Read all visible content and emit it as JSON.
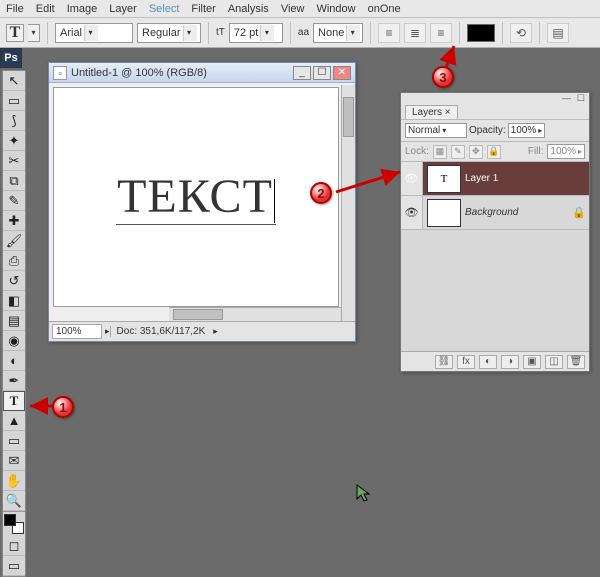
{
  "menu": {
    "items": [
      "File",
      "Edit",
      "Image",
      "Layer",
      "Select",
      "Filter",
      "Analysis",
      "View",
      "Window",
      "onOne"
    ],
    "highlight_index": 4
  },
  "options_bar": {
    "tool_letter": "T",
    "font_family": "Arial",
    "font_style": "Regular",
    "size_prefix_icon": "tT",
    "font_size": "72 pt",
    "aa_prefix": "aa",
    "anti_alias": "None",
    "color_hex": "#000000"
  },
  "app_strip": "Ps",
  "tools": [
    {
      "name": "move-tool",
      "glyph": "↖"
    },
    {
      "name": "marquee-tool",
      "glyph": "▭"
    },
    {
      "name": "lasso-tool",
      "glyph": "⟆"
    },
    {
      "name": "magic-wand-tool",
      "glyph": "✦"
    },
    {
      "name": "crop-tool",
      "glyph": "✂"
    },
    {
      "name": "slice-tool",
      "glyph": "⧉"
    },
    {
      "name": "eyedropper-tool",
      "glyph": "✎"
    },
    {
      "name": "healing-brush-tool",
      "glyph": "✚"
    },
    {
      "name": "brush-tool",
      "glyph": "🖌"
    },
    {
      "name": "clone-stamp-tool",
      "glyph": "⎙"
    },
    {
      "name": "history-brush-tool",
      "glyph": "↺"
    },
    {
      "name": "eraser-tool",
      "glyph": "◧"
    },
    {
      "name": "gradient-tool",
      "glyph": "▤"
    },
    {
      "name": "blur-tool",
      "glyph": "◉"
    },
    {
      "name": "dodge-tool",
      "glyph": "◐"
    },
    {
      "name": "pen-tool",
      "glyph": "✒"
    },
    {
      "name": "type-tool",
      "glyph": "T",
      "selected": true
    },
    {
      "name": "path-selection-tool",
      "glyph": "▲"
    },
    {
      "name": "shape-tool",
      "glyph": "▭"
    },
    {
      "name": "notes-tool",
      "glyph": "✉"
    },
    {
      "name": "hand-tool",
      "glyph": "✋"
    },
    {
      "name": "zoom-tool",
      "glyph": "🔍"
    }
  ],
  "document": {
    "title": "Untitled-1 @ 100% (RGB/8)",
    "text": "ТЕКСТ",
    "zoom": "100%",
    "info": "Doc: 351,6K/117,2K"
  },
  "layers_panel": {
    "tab": "Layers ×",
    "blend_mode": "Normal",
    "opacity_label": "Opacity:",
    "opacity_value": "100%",
    "lock_label": "Lock:",
    "fill_label": "Fill:",
    "fill_value": "100%",
    "rows": [
      {
        "name": "Layer 1",
        "thumb_letter": "T",
        "active": true
      },
      {
        "name": "Background",
        "thumb_letter": "",
        "locked": true
      }
    ]
  },
  "callouts": {
    "c1": "1",
    "c2": "2",
    "c3": "3"
  }
}
